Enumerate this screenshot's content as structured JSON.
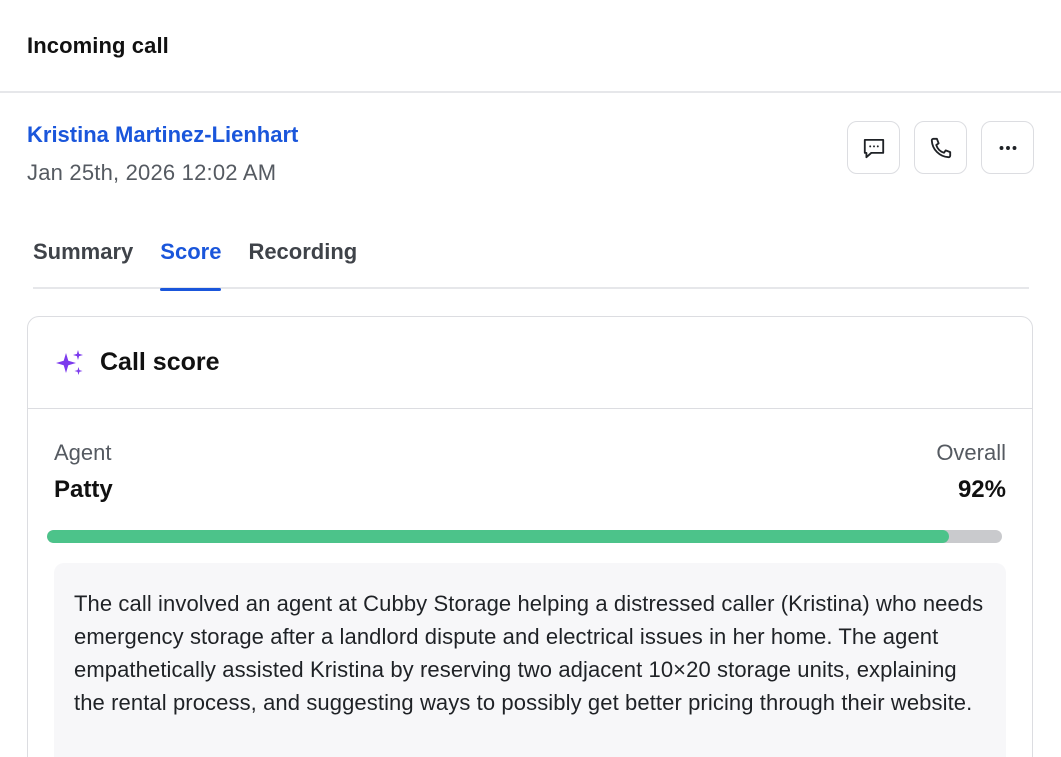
{
  "header": {
    "title": "Incoming call"
  },
  "contact": {
    "name": "Kristina Martinez-Lienhart",
    "datetime": "Jan 25th, 2026 12:02 AM"
  },
  "actions": [
    {
      "name": "message-button",
      "icon": "message-icon"
    },
    {
      "name": "call-button",
      "icon": "phone-icon"
    },
    {
      "name": "more-button",
      "icon": "more-horizontal-icon"
    }
  ],
  "tabs": [
    {
      "label": "Summary",
      "active": false
    },
    {
      "label": "Score",
      "active": true
    },
    {
      "label": "Recording",
      "active": false
    }
  ],
  "card": {
    "title": "Call score",
    "icon": "sparkles-icon",
    "agent_label": "Agent",
    "agent_name": "Patty",
    "overall_label": "Overall",
    "overall_value": "92%",
    "progress_fraction": 0.945,
    "summary": "The call involved an agent at Cubby Storage helping a distressed caller (Kristina) who needs emergency storage after a landlord dispute and electrical issues in her home. The agent empathetically assisted Kristina by reserving two adjacent 10×20 storage units, explaining the rental process, and suggesting ways to possibly get better pricing through their website."
  },
  "colors": {
    "accent": "#1a56db",
    "progress": "#4cc38a",
    "progress_track": "#c9cacd",
    "sparkle": "#7c3aed"
  }
}
